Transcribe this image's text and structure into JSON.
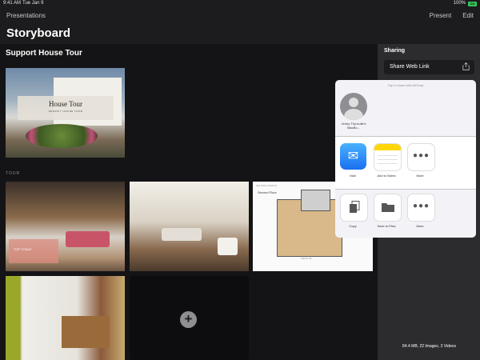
{
  "status_bar": {
    "time": "9:41 AM",
    "date": "Tue Jan 9",
    "battery_pct": "100%",
    "battery_label": "CO"
  },
  "nav": {
    "back": "Presentations",
    "present": "Present",
    "edit": "Edit"
  },
  "page_title": "Storyboard",
  "main": {
    "section_title": "Support House Tour",
    "cover": {
      "title": "House Tour",
      "subtitle": "SHOPIFY HOUSE TOUR"
    },
    "tour_label": "TOUR",
    "photo1_caption": "TOP TODAY",
    "floorplan": {
      "header": "999 MAIN AVENUE",
      "floor": "Second Floor",
      "footer": "UNITS SF"
    },
    "add_icon": "+"
  },
  "sidebar": {
    "title": "Sharing",
    "share_web_link": "Share Web Link",
    "storage": "84.4 MB, 22 Images, 3 Videos"
  },
  "share_sheet": {
    "hint": "Tap to share with AirDrop",
    "airdrop_contact": "Jenny Thy-bulle's MacBo...",
    "apps": [
      {
        "label": "Mail"
      },
      {
        "label": "Add to Notes"
      },
      {
        "label": "More"
      }
    ],
    "actions": [
      {
        "label": "Copy"
      },
      {
        "label": "Save to Files"
      },
      {
        "label": "More"
      }
    ]
  },
  "colors": {
    "background": "#1c1c1e",
    "sidebar": "#2c2c2e",
    "sheet": "#f2f2f7",
    "battery": "#34c759"
  },
  "icons": [
    "share-icon",
    "mail-icon",
    "notes-icon",
    "more-icon",
    "copy-icon",
    "folder-icon",
    "add-icon"
  ]
}
